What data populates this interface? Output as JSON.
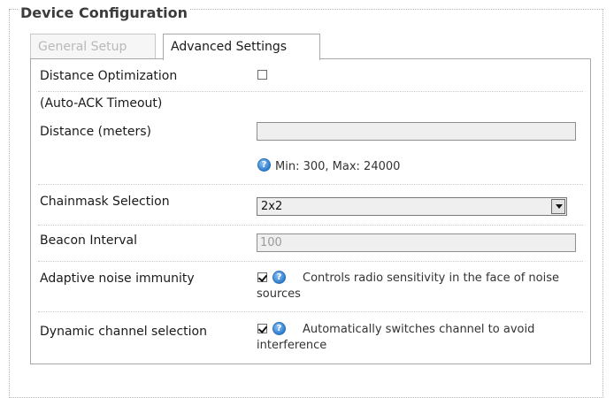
{
  "fieldset": {
    "legend": "Device Configuration"
  },
  "tabs": [
    {
      "label": "General Setup",
      "active": false
    },
    {
      "label": "Advanced Settings",
      "active": true
    }
  ],
  "rows": {
    "distance_optimization": {
      "label": "Distance Optimization",
      "checked": false
    },
    "auto_ack": {
      "label": "(Auto-ACK Timeout)"
    },
    "distance": {
      "label": "Distance (meters)",
      "value": "",
      "hint": "Min: 300, Max: 24000"
    },
    "chainmask": {
      "label": "Chainmask Selection",
      "selected": "2x2"
    },
    "beacon": {
      "label": "Beacon Interval",
      "value": "100"
    },
    "adaptive_noise": {
      "label": "Adaptive noise immunity",
      "checked": true,
      "description": "Controls radio sensitivity in the face of noise sources"
    },
    "dynamic_channel": {
      "label": "Dynamic channel selection",
      "checked": true,
      "description": "Automatically switches channel to avoid interference"
    }
  },
  "icons": {
    "help": "help-icon",
    "help_glyph": "?"
  },
  "colors": {
    "help_icon_blue": "#2f7fd1",
    "border": "#a8a8a8",
    "disabled_field": "#efefef"
  }
}
